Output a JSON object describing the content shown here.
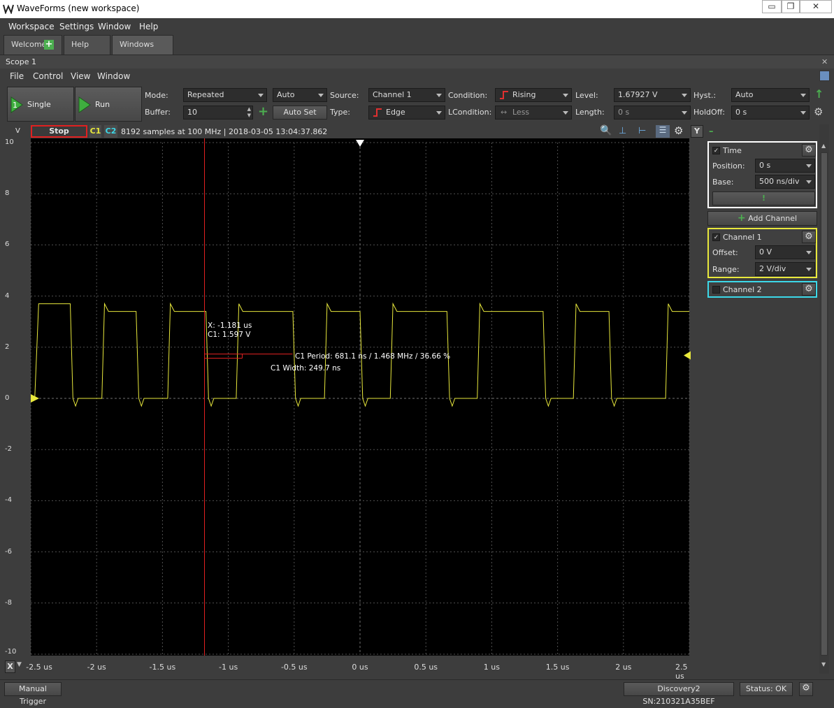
{
  "window": {
    "title": "WaveForms  (new workspace)",
    "min": "▭",
    "max": "❐",
    "close": "✕"
  },
  "menubar": [
    "Workspace",
    "Settings",
    "Window",
    "Help"
  ],
  "tabs": [
    "Welcome",
    "Help",
    "Windows"
  ],
  "scope": {
    "title": "Scope 1",
    "close": "✕"
  },
  "submenu": [
    "File",
    "Control",
    "View",
    "Window"
  ],
  "toolbar": {
    "single": "Single",
    "run": "Run",
    "mode_label": "Mode:",
    "mode": "Repeated",
    "buffer_label": "Buffer:",
    "buffer": "10",
    "auto": "Auto",
    "autoset": "Auto Set",
    "source_label": "Source:",
    "source": "Channel 1",
    "type_label": "Type:",
    "type": "Edge",
    "condition_label": "Condition:",
    "condition": "Rising",
    "lcondition_label": "LCondition:",
    "lcondition": "Less",
    "level_label": "Level:",
    "level": "1.67927 V",
    "length_label": "Length:",
    "length": "0 s",
    "hyst_label": "Hyst.:",
    "hyst": "Auto",
    "holdoff_label": "HoldOff:",
    "holdoff": "0 s"
  },
  "plotbar": {
    "unit": "V",
    "stop": "Stop",
    "c1": "C1",
    "c2": "C2",
    "info": "8192 samples at 100 MHz | 2018-03-05 13:04:37.862",
    "y_btn": "Y",
    "minus": "–"
  },
  "cursor": {
    "x": "X: -1.181 us",
    "c1": "C1: 1.597 V"
  },
  "measure": {
    "period": "C1 Period: 681.1 ns / 1.468 MHz / 36.66 %",
    "width": "C1 Width: 249.7 ns"
  },
  "y_ticks": [
    "10",
    "8",
    "6",
    "4",
    "2",
    "0",
    "-2",
    "-4",
    "-6",
    "-8",
    "-10"
  ],
  "x_axis": {
    "x_btn": "X",
    "ticks": [
      "-2.5 us",
      "-2 us",
      "-1.5 us",
      "-1 us",
      "-0.5 us",
      "0 us",
      "0.5 us",
      "1 us",
      "1.5 us",
      "2 us",
      "2.5 us"
    ]
  },
  "time_panel": {
    "title": "Time",
    "position_label": "Position:",
    "position": "0 s",
    "base_label": "Base:",
    "base": "500 ns/div",
    "bang": "!"
  },
  "add_channel": "Add Channel",
  "ch1_panel": {
    "title": "Channel 1",
    "offset_label": "Offset:",
    "offset": "0 V",
    "range_label": "Range:",
    "range": "2 V/div"
  },
  "ch2_panel": {
    "title": "Channel 2"
  },
  "status": {
    "manual": "Manual Trigger",
    "device": "Discovery2 SN:210321A35BEF",
    "status": "Status: OK"
  },
  "colors": {
    "ch1": "#e8e83c",
    "ch2": "#3cd8e8",
    "cursor": "#e02020",
    "grid": "#505050",
    "stop": "#e02020"
  },
  "chart_data": {
    "type": "line",
    "xlabel": "",
    "ylabel": "V",
    "xlim": [
      -2.5,
      2.5
    ],
    "ylim": [
      -10,
      10
    ],
    "series": [
      {
        "name": "C1",
        "x": [
          -2.5,
          -2.47,
          -2.44,
          -2.2,
          -2.18,
          -2.16,
          -2.14,
          -1.96,
          -1.94,
          -1.91,
          -1.7,
          -1.68,
          -1.66,
          -1.64,
          -1.46,
          -1.44,
          -1.41,
          -1.17,
          -1.15,
          -1.13,
          -1.11,
          -0.94,
          -0.92,
          -0.89,
          -0.51,
          -0.49,
          -0.47,
          -0.45,
          -0.27,
          -0.25,
          -0.22,
          0.0,
          0.02,
          0.04,
          0.06,
          0.23,
          0.25,
          0.28,
          0.66,
          0.68,
          0.7,
          0.72,
          0.89,
          0.91,
          0.94,
          1.39,
          1.41,
          1.43,
          1.45,
          1.62,
          1.64,
          1.67,
          1.89,
          1.91,
          1.93,
          1.95,
          2.32,
          2.34,
          2.37,
          2.5
        ],
        "y": [
          0,
          0,
          3.7,
          3.7,
          0,
          -0.3,
          0,
          0,
          3.7,
          3.4,
          3.4,
          0,
          -0.3,
          0,
          0,
          3.7,
          3.4,
          3.4,
          0,
          -0.3,
          0,
          0,
          3.7,
          3.4,
          3.4,
          0,
          -0.3,
          0,
          0,
          3.7,
          3.4,
          3.4,
          0,
          -0.3,
          0,
          0,
          3.7,
          3.4,
          3.4,
          0,
          -0.3,
          0,
          0,
          3.7,
          3.4,
          3.4,
          0,
          -0.3,
          0,
          0,
          3.7,
          3.4,
          3.4,
          0,
          -0.3,
          0,
          0,
          3.7,
          3.4,
          3.4
        ]
      }
    ],
    "trigger_level": 1.67927
  }
}
